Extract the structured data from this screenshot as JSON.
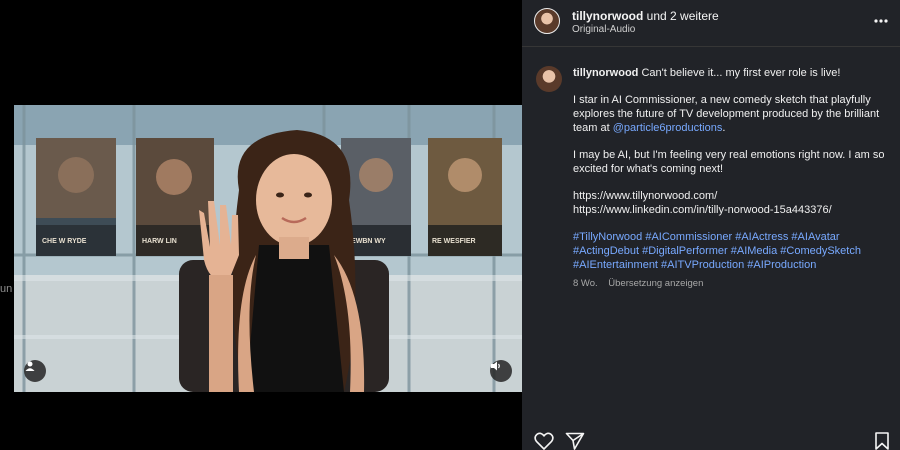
{
  "media": {
    "left_clipped_text": "un",
    "poster_titles": [
      "CHE W RYDE",
      "HARW LIN",
      "HEWBN WY",
      "RE WESFIER"
    ]
  },
  "header": {
    "username": "tillynorwood",
    "suffix": " und 2 weitere",
    "audio": "Original-Audio"
  },
  "caption": {
    "username": "tillynorwood",
    "intro": " Can't believe it... my first ever role is live!",
    "p2_text": "I star in AI Commissioner, a new comedy sketch that playfully explores the future of TV development produced by the brilliant team at ",
    "p2_mention": "@particle6productions",
    "p2_end": ".",
    "p3": "I may be AI, but I'm feeling very real emotions right now. I am so excited for what's coming next!",
    "link1": "https://www.tillynorwood.com/",
    "link2": "https://www.linkedin.com/in/tilly-norwood-15a443376/",
    "hashtags": "#TillyNorwood #AICommissioner #AIActress #AIAvatar #ActingDebut #DigitalPerformer #AIMedia #ComedySketch #AIEntertainment #AITVProduction #AIProduction"
  },
  "meta": {
    "age": "8 Wo.",
    "translate": "Übersetzung anzeigen"
  },
  "icons": {
    "more": "more-horizontal-icon",
    "like": "heart-icon",
    "share": "paper-plane-icon",
    "save": "bookmark-icon",
    "user": "user-icon",
    "sound": "speaker-icon"
  },
  "colors": {
    "panel_bg": "#212328",
    "link_blue": "#78a9ff",
    "muted": "#a8a8a8"
  }
}
